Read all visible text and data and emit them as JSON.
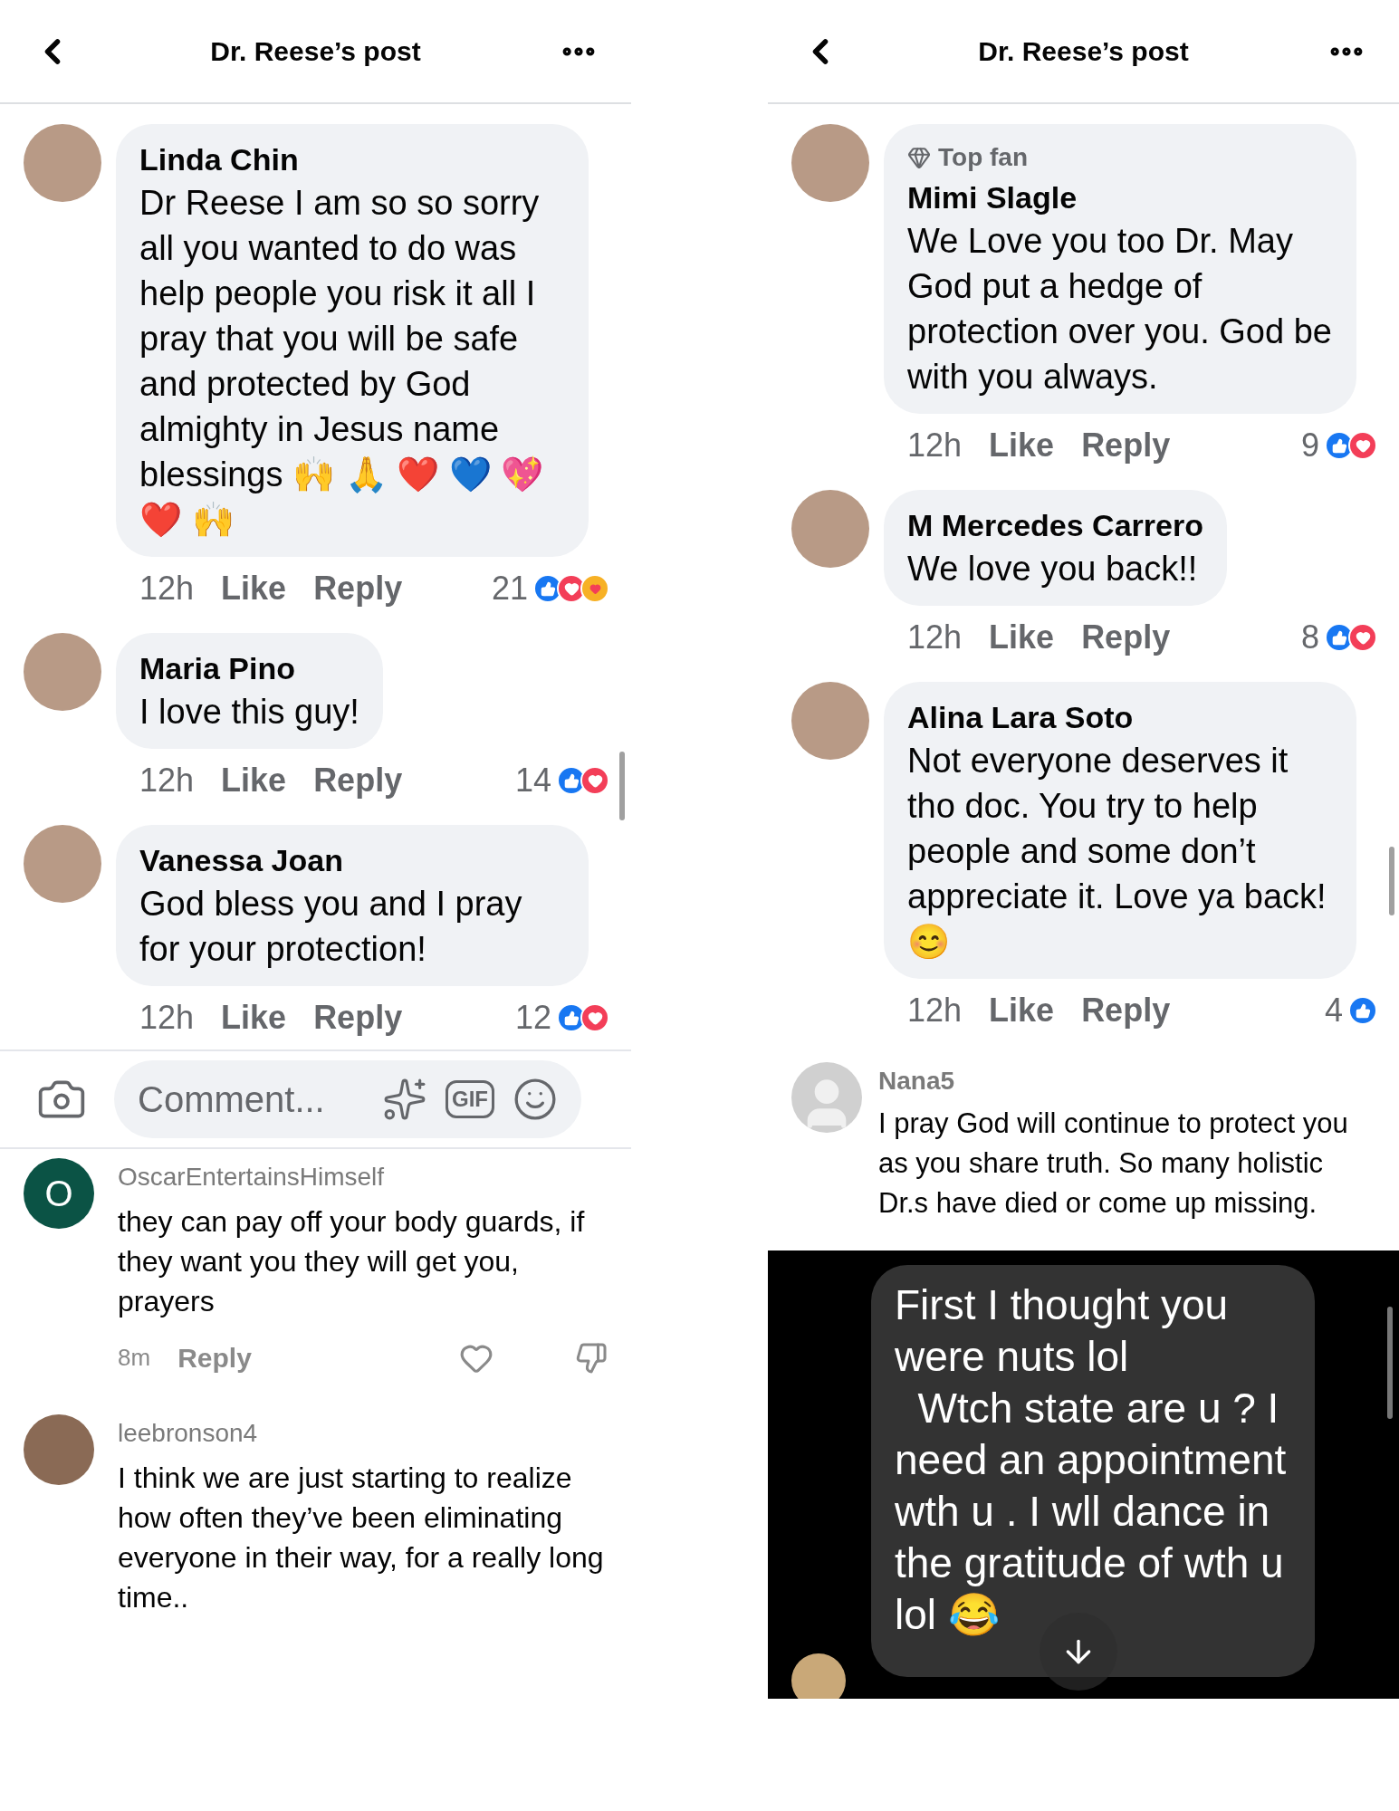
{
  "left_post": {
    "header": {
      "title": "Dr. Reese’s post"
    },
    "comments": [
      {
        "author": "Linda Chin",
        "text": "Dr Reese I am so so sorry all you wanted to do was help people you risk it all I pray that you will be safe and protected by  God almighty in Jesus name blessings 🙌 🙏 ❤️ 💙 💖 ❤️ 🙌",
        "time": "12h",
        "like": "Like",
        "reply": "Reply",
        "count": "21",
        "reactions": [
          {
            "kind": "like"
          },
          {
            "kind": "love"
          },
          {
            "kind": "care"
          }
        ]
      },
      {
        "author": "Maria Pino",
        "text": "I love this guy!",
        "time": "12h",
        "like": "Like",
        "reply": "Reply",
        "count": "14",
        "reactions": [
          {
            "kind": "like"
          },
          {
            "kind": "love"
          }
        ]
      },
      {
        "author": "Vanessa Joan",
        "text": "God bless you and I pray for your protection!",
        "time": "12h",
        "like": "Like",
        "reply": "Reply",
        "count": "12",
        "reactions": [
          {
            "kind": "like"
          },
          {
            "kind": "love"
          }
        ]
      }
    ],
    "composer": {
      "placeholder": "Comment...",
      "gif": "GIF"
    }
  },
  "left_video_comments": [
    {
      "author": "OscarEntertainsHimself",
      "avatar_letter": "O",
      "text": "they can pay off your body guards, if they want you they will get you, prayers",
      "time": "8m",
      "reply": "Reply"
    },
    {
      "author": "leebronson4",
      "text": "I think we are just starting to realize how often they’ve been eliminating everyone in their way, for a really long time.."
    }
  ],
  "right_post": {
    "header": {
      "title": "Dr. Reese’s post"
    },
    "comments": [
      {
        "author": "Mimi Slagle",
        "badge": "Top fan",
        "text": "We Love you too Dr. May God put a hedge of protection over you. God be with you always.",
        "time": "12h",
        "like": "Like",
        "reply": "Reply",
        "count": "9",
        "reactions": [
          {
            "kind": "like"
          },
          {
            "kind": "love"
          }
        ]
      },
      {
        "author": "M Mercedes Carrero",
        "text": "We love you back!!",
        "time": "12h",
        "like": "Like",
        "reply": "Reply",
        "count": "8",
        "reactions": [
          {
            "kind": "like"
          },
          {
            "kind": "love"
          }
        ]
      },
      {
        "author": "Alina Lara Soto",
        "text": "Not everyone deserves it tho doc. You try to help people and some don’t appreciate it. Love ya back! 😊",
        "time": "12h",
        "like": "Like",
        "reply": "Reply",
        "count": "4",
        "reactions": [
          {
            "kind": "like"
          }
        ]
      }
    ],
    "plain_comment": {
      "author": "Nana5",
      "text": "I pray God will continue to protect you as you share truth. So many holistic Dr.s have died or come up missing."
    }
  },
  "right_chat": {
    "message": "First I thought you were nuts lol\n  Wtch state are u ? I need an appointment wth u . I wll dance in the gratitude of wth u lol 😂"
  }
}
